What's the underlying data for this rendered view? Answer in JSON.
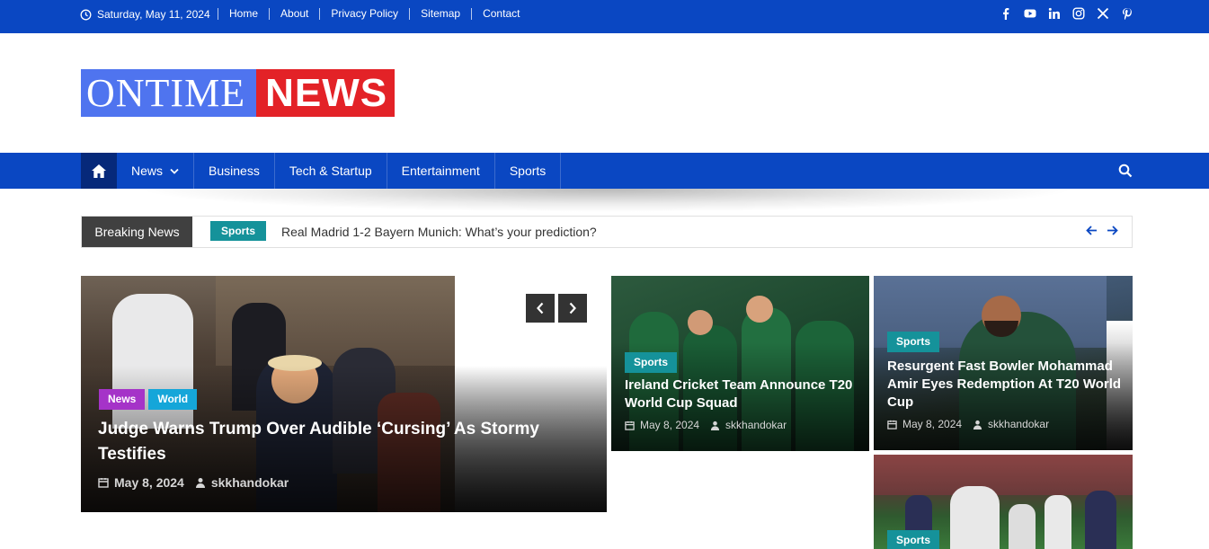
{
  "topbar": {
    "date": "Saturday, May 11, 2024",
    "links": [
      "Home",
      "About",
      "Privacy Policy",
      "Sitemap",
      "Contact"
    ],
    "social_icons": [
      "facebook-icon",
      "youtube-icon",
      "linkedin-icon",
      "instagram-icon",
      "x-icon",
      "pinterest-icon"
    ]
  },
  "logo": {
    "part1": "ONTIME",
    "part2": "NEWS"
  },
  "nav": {
    "items": [
      "News",
      "Business",
      "Tech & Startup",
      "Entertainment",
      "Sports"
    ]
  },
  "breaking": {
    "label": "Breaking News",
    "category": "Sports",
    "title": "Real Madrid 1-2 Bayern Munich: What’s your prediction?"
  },
  "main_post": {
    "categories": [
      "News",
      "World"
    ],
    "title": "Judge Warns Trump Over Audible ‘Cursing’ As Stormy Testifies",
    "date": "May 8, 2024",
    "author": "skkhandokar"
  },
  "post2": {
    "category": "Sports",
    "title": "Ireland Cricket Team Announce T20 World Cup Squad",
    "date": "May 8, 2024",
    "author": "skkhandokar"
  },
  "post3": {
    "category": "Sports",
    "title": "Resurgent Fast Bowler Mohammad Amir Eyes Redemption At T20 World Cup",
    "date": "May 8, 2024",
    "author": "skkhandokar"
  },
  "post4": {
    "category": "Sports"
  },
  "colors": {
    "primary": "#0a47c2",
    "dark_nav": "#06297a",
    "logo_blue": "#4f74ef",
    "logo_red": "#e32227",
    "teal": "#15929a",
    "purple": "#a533c8",
    "cyan": "#15a6d9"
  }
}
